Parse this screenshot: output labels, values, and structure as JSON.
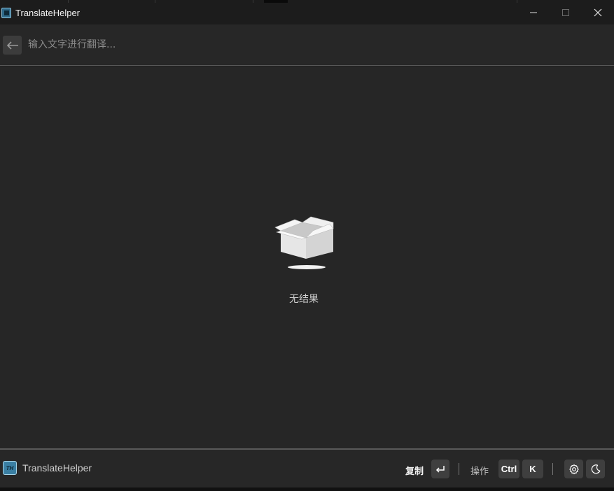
{
  "window": {
    "title": "TranslateHelper",
    "minimize_icon": "minimize-icon",
    "maximize_icon": "maximize-icon",
    "close_icon": "close-icon"
  },
  "search": {
    "back_icon": "arrow-left-icon",
    "placeholder": "输入文字进行翻译...",
    "value": ""
  },
  "results": {
    "empty_icon": "empty-box-icon",
    "empty_text": "无结果"
  },
  "footer": {
    "app_name": "TranslateHelper",
    "app_icon_text": "TH",
    "copy_label": "复制",
    "enter_key_icon": "enter-key-icon",
    "actions_label": "操作",
    "ctrl_key": "Ctrl",
    "k_key": "K",
    "settings_icon": "gear-icon",
    "theme_icon": "moon-icon"
  },
  "colors": {
    "background": "#262626",
    "titlebar": "#1c1c1c",
    "key_bg": "#3f3f3f",
    "brand": "#3a7fa3"
  }
}
